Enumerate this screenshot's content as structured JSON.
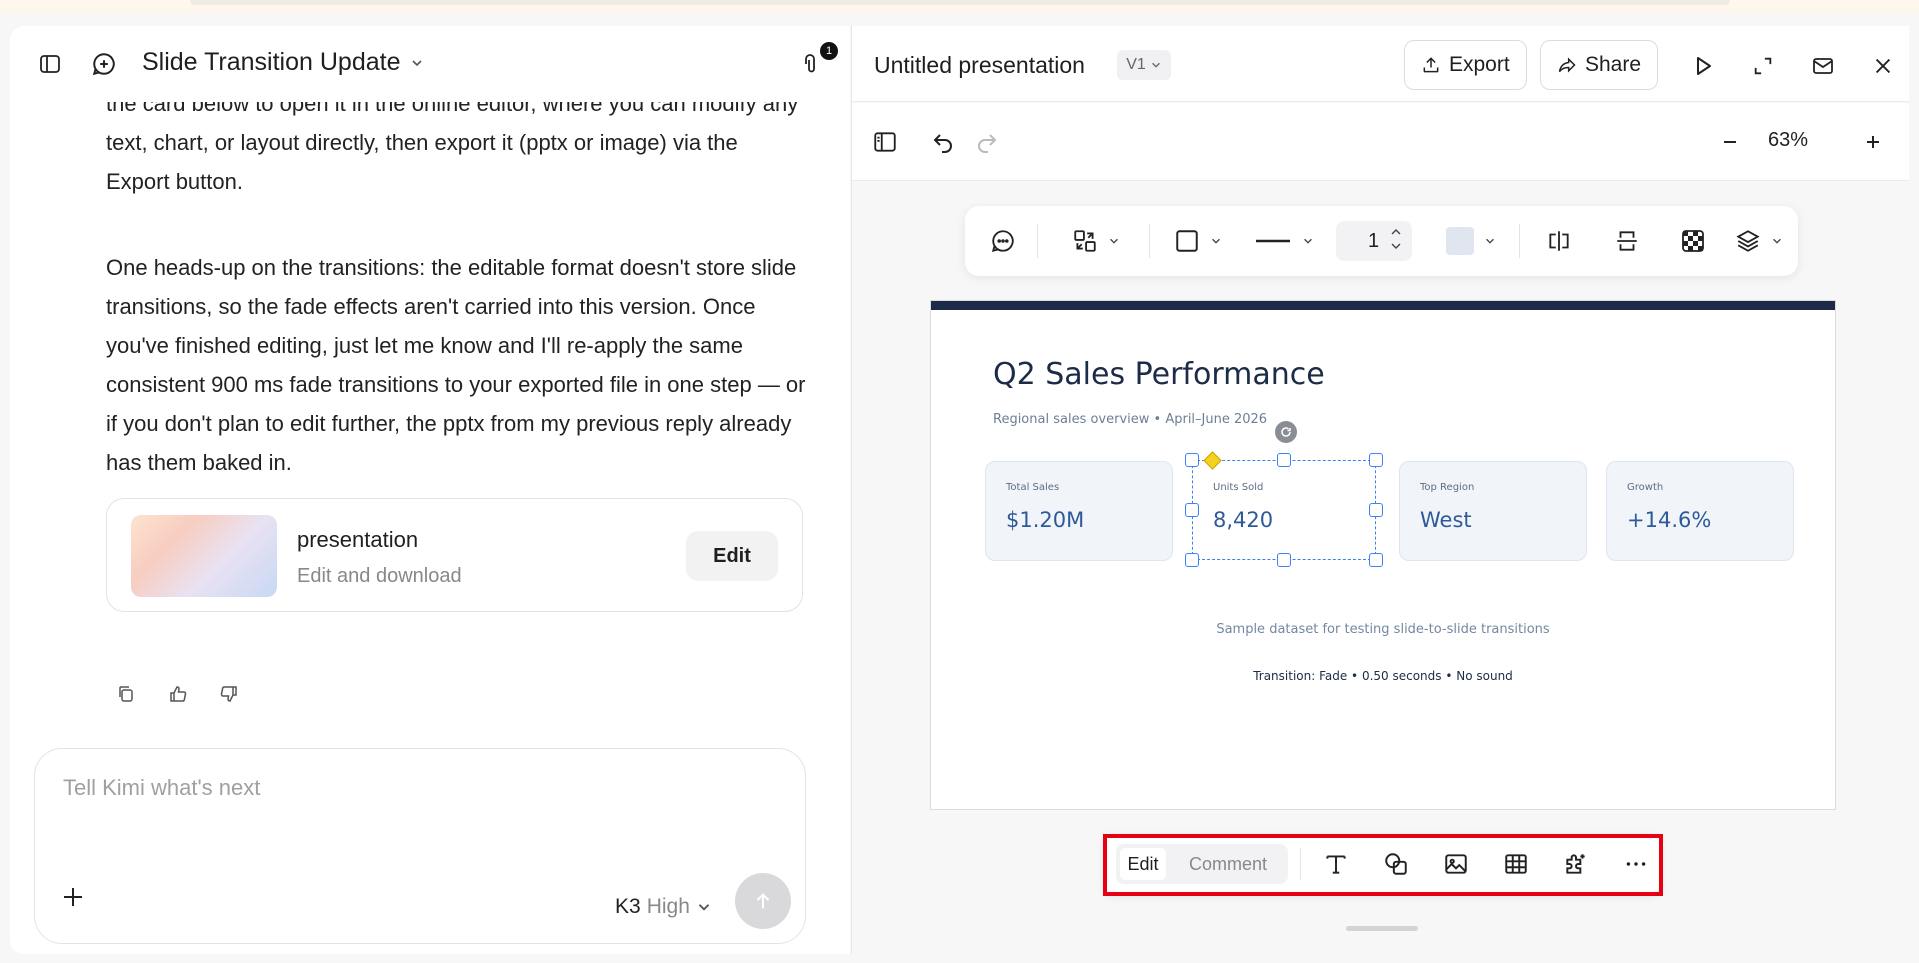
{
  "chat": {
    "title": "Slide Transition Update",
    "attachment_count": "1",
    "messages": [
      "the card below to open it in the online editor, where you can modify any text, chart, or layout directly, then export it (pptx or image) via the Export button.",
      "One heads-up on the transitions: the editable format doesn't store slide transitions, so the fade effects aren't carried into this version. Once you've finished editing, just let me know and I'll re-apply the same consistent 900 ms fade transitions to your exported file in one step — or if you don't plan to edit further, the pptx from my previous reply already has them baked in."
    ],
    "card": {
      "title": "presentation",
      "subtitle": "Edit and download",
      "button": "Edit"
    },
    "composer": {
      "placeholder": "Tell Kimi what's next",
      "model": "K3",
      "level": "High"
    }
  },
  "editor": {
    "title": "Untitled presentation",
    "version": "V1",
    "export_label": "Export",
    "share_label": "Share",
    "zoom": "63%",
    "stroke_width": "1",
    "fill_color": "#dfe6ef",
    "slide": {
      "title": "Q2 Sales Performance",
      "subtitle": "Regional sales overview  •  April–June 2026",
      "kpis": [
        {
          "label": "Total Sales",
          "value": "$1.20M"
        },
        {
          "label": "Units Sold",
          "value": "8,420"
        },
        {
          "label": "Top Region",
          "value": "West"
        },
        {
          "label": "Growth",
          "value": "+14.6%"
        }
      ],
      "footnote": "Sample dataset for testing slide-to-slide transitions",
      "transition_info": "Transition: Fade  •  0.50 seconds  •  No sound"
    },
    "bottom_toolbar": {
      "edit_label": "Edit",
      "comment_label": "Comment",
      "tools": [
        "text-icon",
        "shapes-icon",
        "image-icon",
        "table-icon",
        "plugin-icon",
        "more-icon"
      ]
    }
  },
  "colors": {
    "slide_accent": "#1c2b47",
    "kpi_value": "#2e5a99",
    "selection": "#3b82f6",
    "highlight": "#e60012"
  }
}
